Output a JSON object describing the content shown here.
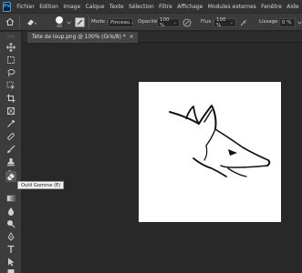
{
  "app": {
    "logo_text": "Ps"
  },
  "menu": [
    "Fichier",
    "Edition",
    "Image",
    "Calque",
    "Texte",
    "Sélection",
    "Filtre",
    "Affichage",
    "Modules externes",
    "Fenêtre",
    "Aide"
  ],
  "options": {
    "brush_size": "40",
    "mode_label": "Mode :",
    "mode_value": "Pinceau",
    "opacity_label": "Opacité :",
    "opacity_value": "100 %",
    "flow_label": "Flux :",
    "flow_value": "100 %",
    "smoothing_label": "Lissage :",
    "smoothing_value": "0 %"
  },
  "document": {
    "tab_title": "Tete de loup.png @ 100% (Gris/8) *",
    "close_glyph": "×"
  },
  "tooltip": {
    "text": "Outil Gomme (E)"
  },
  "colors": {
    "accent": "#31a8ff",
    "panel": "#3c3c3c",
    "canvas_bg": "#282828",
    "artboard": "#ffffff"
  },
  "icons": [
    "move-icon",
    "artboard-icon",
    "lasso-icon",
    "object-select-icon",
    "crop-icon",
    "frame-icon",
    "eyedropper-icon",
    "healing-brush-icon",
    "brush-icon",
    "clone-stamp-icon",
    "history-brush-icon",
    "eraser-icon",
    "gradient-icon",
    "blur-icon",
    "dodge-icon",
    "pen-icon",
    "type-icon",
    "path-select-icon",
    "rectangle-icon",
    "hand-icon"
  ]
}
